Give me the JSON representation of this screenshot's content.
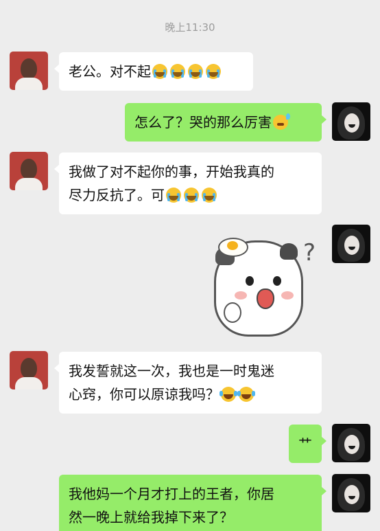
{
  "timestamp": "晚上11:30",
  "messages": [
    {
      "sender": "her",
      "text": "老公。对不起",
      "emojis": [
        "cry",
        "cry",
        "cry",
        "cry"
      ]
    },
    {
      "sender": "him",
      "text": "怎么了？哭的那么厉害",
      "emojis": [
        "sweat"
      ]
    },
    {
      "sender": "her",
      "line1": "我做了对不起你的事，开始我真的",
      "line2": "尽力反抗了。可",
      "emojis": [
        "cry",
        "cry",
        "cry"
      ]
    },
    {
      "sender": "him",
      "sticker": "confused-cat-sticker",
      "sticker_mark": "?"
    },
    {
      "sender": "her",
      "line1": "我发誓就这一次，我也是一时鬼迷",
      "line2": "心窍，你可以原谅我吗？",
      "emojis": [
        "laugh-cry",
        "laugh-cry"
      ]
    },
    {
      "sender": "him",
      "text": "艹"
    },
    {
      "sender": "him",
      "line1": "我他妈一个月才打上的王者，你居",
      "line2": "然一晚上就给我掉下来了？"
    }
  ],
  "colors": {
    "background": "#ededed",
    "incoming_bubble": "#ffffff",
    "outgoing_bubble": "#95ec69"
  }
}
